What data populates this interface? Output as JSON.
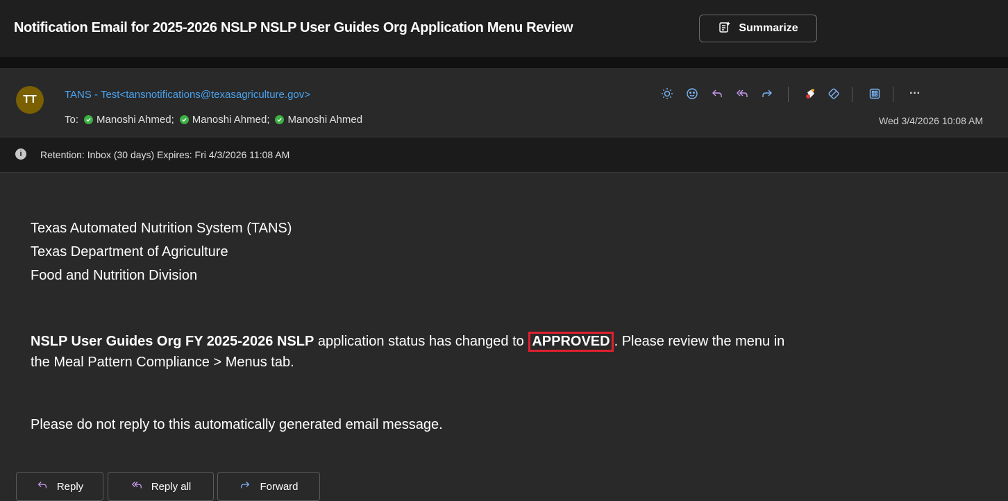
{
  "window": {
    "title": "Notification Email for 2025-2026 NSLP NSLP User Guides Org Application Menu Review",
    "summarize_label": "Summarize"
  },
  "header": {
    "avatar_initials": "TT",
    "sender": "TANS - Test<tansnotifications@texasagriculture.gov>",
    "to_label": "To:",
    "recipients": [
      "Manoshi Ahmed;",
      "Manoshi Ahmed;",
      "Manoshi Ahmed"
    ],
    "date": "Wed 3/4/2026 10:08 AM",
    "more_label": "···",
    "toolbar_icons": [
      "sun-icon",
      "emoji-icon",
      "reply-icon",
      "reply-all-icon",
      "forward-icon",
      "tag-icon",
      "diamond-icon",
      "apps-icon",
      "more-icon"
    ]
  },
  "retention": {
    "text": "Retention: Inbox (30 days) Expires: Fri 4/3/2026 11:08 AM"
  },
  "body": {
    "org_line1": "Texas Automated Nutrition System (TANS)",
    "org_line2": "Texas Department of Agriculture",
    "org_line3": "Food and Nutrition Division",
    "status_bold": "NSLP User Guides Org FY 2025-2026 NSLP",
    "status_mid": " application status has changed to ",
    "status_value": "APPROVED",
    "status_after": ". Please review the menu in",
    "status_line2": "the Meal Pattern Compliance > Menus tab.",
    "footer_note": "Please do not reply to this automatically generated email message."
  },
  "actions": {
    "reply": "Reply",
    "reply_all": "Reply all",
    "forward": "Forward"
  },
  "colors": {
    "accent_link": "#4aa3f0",
    "highlight_border": "#e0202e",
    "presence_green": "#3cb043",
    "avatar_bg": "#7a6000"
  }
}
